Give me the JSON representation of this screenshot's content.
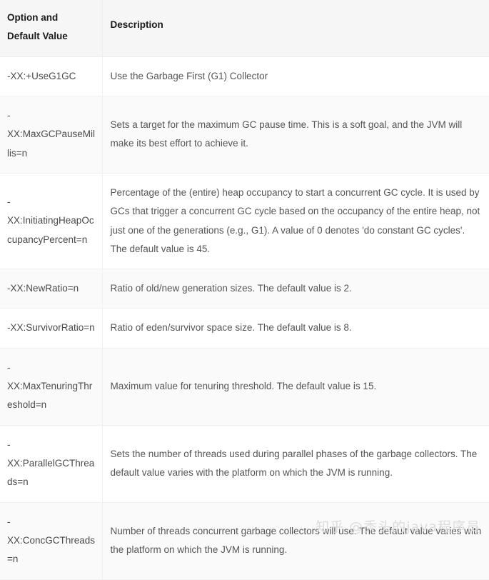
{
  "table": {
    "headers": {
      "option": "Option and Default Value",
      "description": "Description"
    },
    "rows": [
      {
        "option": "-XX:+UseG1GC",
        "description": "Use the Garbage First (G1) Collector"
      },
      {
        "option": "-XX:MaxGCPauseMillis=n",
        "description": "Sets a target for the maximum GC pause time. This is a soft goal, and the JVM will make its best effort to achieve it."
      },
      {
        "option": "-XX:InitiatingHeapOccupancyPercent=n",
        "description": "Percentage of the (entire) heap occupancy to start a concurrent GC cycle. It is used by GCs that trigger a concurrent GC cycle based on the occupancy of the entire heap, not just one of the generations (e.g., G1). A value of 0 denotes 'do constant GC cycles'. The default value is 45."
      },
      {
        "option": "-XX:NewRatio=n",
        "description": "Ratio of old/new generation sizes. The default value is 2."
      },
      {
        "option": "-XX:SurvivorRatio=n",
        "description": "Ratio of eden/survivor space size. The default value is 8."
      },
      {
        "option": "-XX:MaxTenuringThreshold=n",
        "description": "Maximum value for tenuring threshold. The default value is 15."
      },
      {
        "option": "-XX:ParallelGCThreads=n",
        "description": "Sets the number of threads used during parallel phases of the garbage collectors. The default value varies with the platform on which the JVM is running."
      },
      {
        "option": "-XX:ConcGCThreads=n",
        "description": "Number of threads concurrent garbage collectors will use. The default value varies with the platform on which the JVM is running."
      }
    ]
  },
  "watermark": {
    "text": "知乎 @秃头的java程序员"
  },
  "colors": {
    "header_background": "#f6f6f6",
    "row_alt_background": "#fafafa",
    "row_background": "#ffffff",
    "border": "#f0f0f0",
    "header_text": "#1a1a1a",
    "body_text": "#555555",
    "watermark_text": "#dcdcdc"
  }
}
